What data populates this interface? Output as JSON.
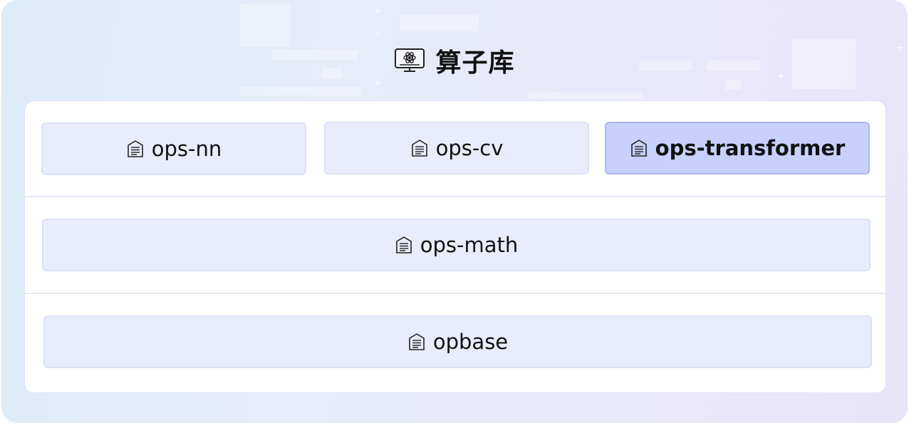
{
  "header": {
    "title": "算子库",
    "icon": "operator-library-icon"
  },
  "rows": [
    {
      "items": [
        {
          "label": "ops-nn",
          "icon": "document-icon",
          "active": false
        },
        {
          "label": "ops-cv",
          "icon": "document-icon",
          "active": false
        },
        {
          "label": "ops-transformer",
          "icon": "document-icon",
          "active": true
        }
      ]
    },
    {
      "items": [
        {
          "label": "ops-math",
          "icon": "document-icon",
          "active": false
        }
      ]
    },
    {
      "items": [
        {
          "label": "opbase",
          "icon": "document-icon",
          "active": false
        }
      ]
    }
  ],
  "colors": {
    "chip_bg": "#e9ecfc",
    "chip_active_bg": "#c7d1fb",
    "chip_active_border": "#a9b6ef",
    "title_text": "#111111"
  }
}
